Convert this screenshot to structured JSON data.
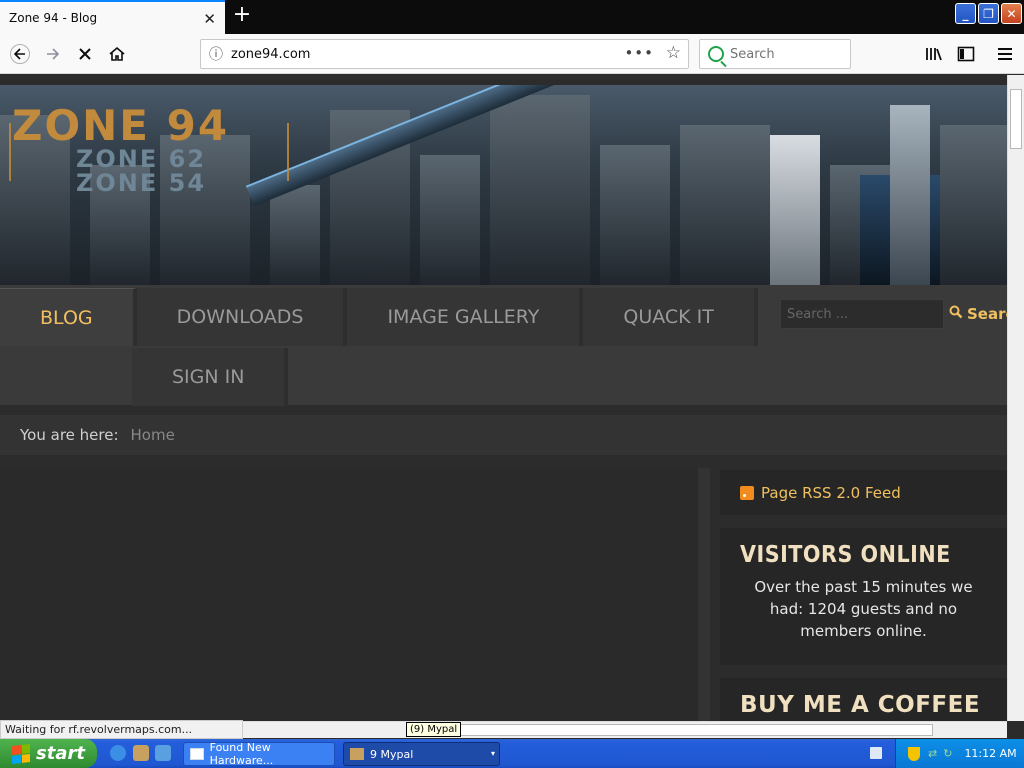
{
  "browser": {
    "tab_title": "Zone 94 - Blog",
    "url": "zone94.com",
    "search_placeholder": "Search",
    "status_text": "Waiting for rf.revolvermaps.com...",
    "tooltip_text": "(9) Mypal"
  },
  "site": {
    "logo_main": "ZONE 94",
    "logo_sub1": "ZONE 62",
    "logo_sub2": "ZONE 54",
    "menu": {
      "items": [
        "BLOG",
        "DOWNLOADS",
        "IMAGE GALLERY",
        "QUACK IT"
      ],
      "second_row": [
        "SIGN IN"
      ],
      "active": "BLOG",
      "search_placeholder": "Search ...",
      "search_button": "Search"
    },
    "breadcrumb": {
      "label": "You are here:",
      "home": "Home"
    },
    "sidebar": {
      "rss_label": "Page RSS 2.0 Feed",
      "visitors_title": "VISITORS ONLINE",
      "visitors_text": "Over the past 15 minutes we had: 1204 guests and no members online.",
      "coffee_title": "BUY ME A COFFEE"
    }
  },
  "taskbar": {
    "start_label": "start",
    "buttons": [
      "Found New Hardware...",
      "9 Mypal"
    ],
    "clock": "11:12 AM"
  },
  "colors": {
    "accent": "#f0c060",
    "tab_highlight": "#0a84ff",
    "taskbar": "#245edb"
  }
}
